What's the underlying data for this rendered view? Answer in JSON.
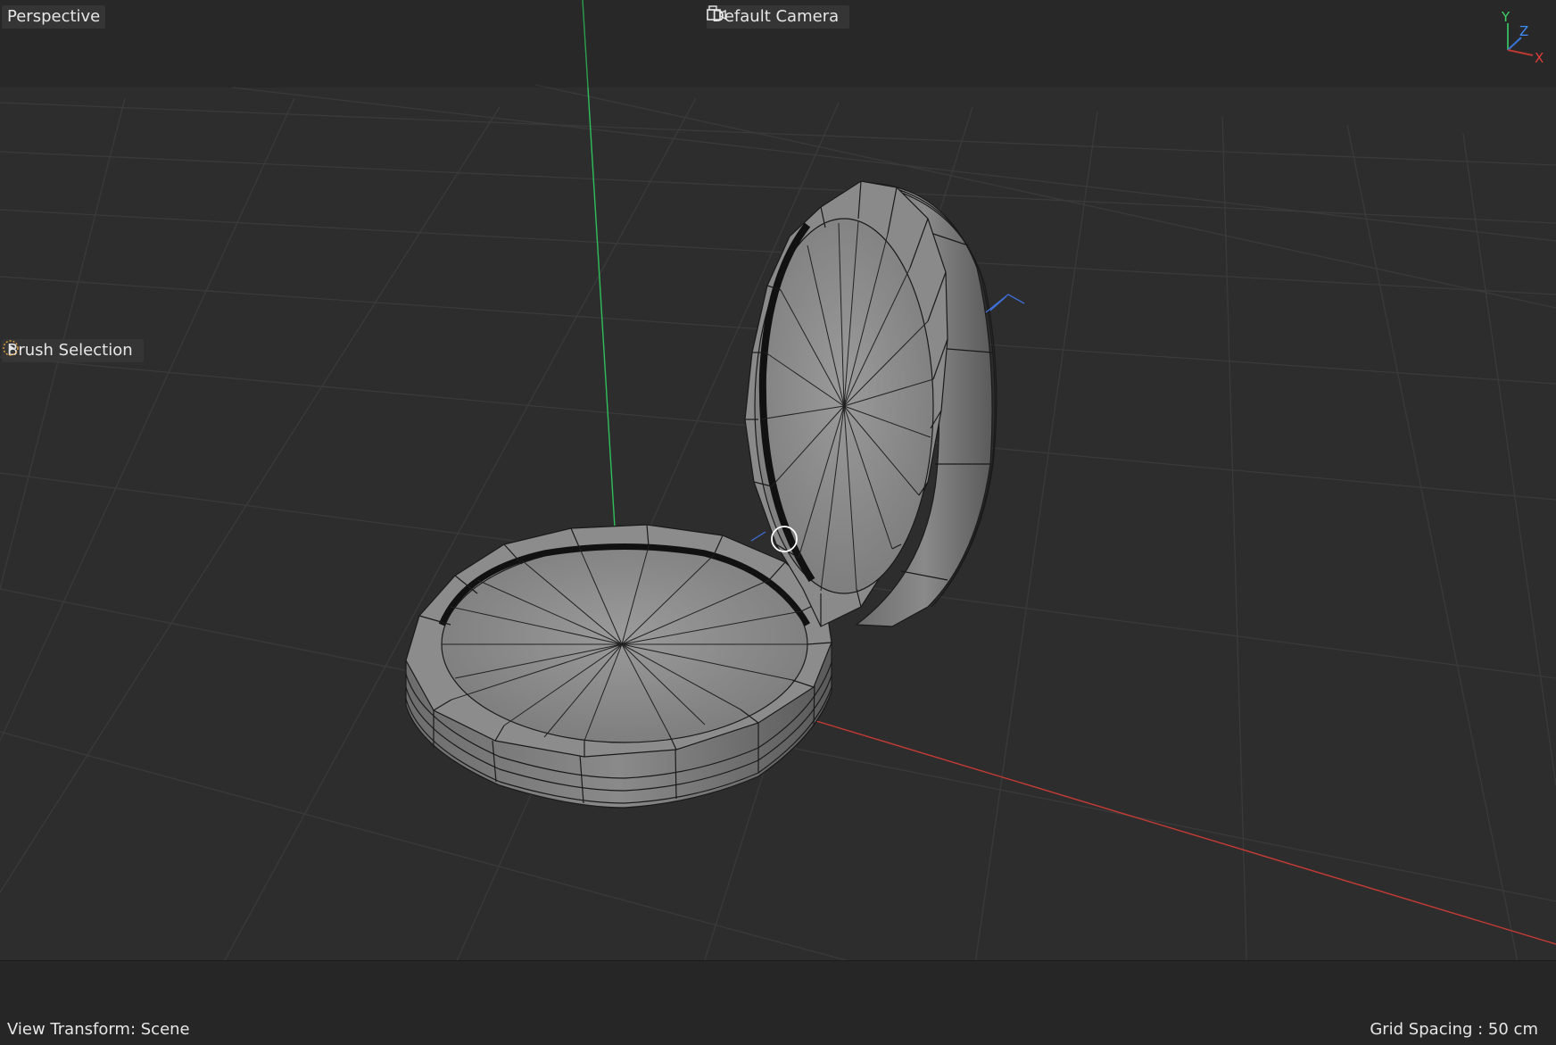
{
  "viewport": {
    "view_name": "Perspective",
    "camera_name": "Default Camera",
    "camera_icon": "camera-icon",
    "tool_name": "Brush Selection",
    "tool_icon": "brush-selection-icon",
    "view_transform": "View Transform: Scene",
    "grid_spacing": "Grid Spacing : 50 cm"
  },
  "axis_gizmo": {
    "y_label": "Y",
    "z_label": "Z",
    "x_label": "X",
    "y_color": "#3fd06a",
    "z_color": "#3f8cff",
    "x_color": "#e0403a"
  },
  "colors": {
    "background": "#2d2d2d",
    "grid_line": "#3b3b3b",
    "mesh_face": "#8f8f8f",
    "mesh_edge": "#1a1a1a",
    "axis_y": "#2fbf5a",
    "axis_x": "#c63b35"
  }
}
